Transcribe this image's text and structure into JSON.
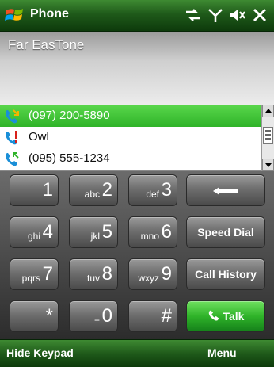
{
  "titlebar": {
    "title": "Phone",
    "start_icon": "windows-flag-icon",
    "status_icons": [
      "data-connection-icon",
      "signal-icon",
      "volume-icon",
      "close-icon"
    ]
  },
  "info": {
    "carrier": "Far EasTone"
  },
  "call_list": {
    "items": [
      {
        "label": "(097) 200-5890",
        "icon": "incoming-call-icon",
        "selected": true
      },
      {
        "label": "Owl",
        "icon": "missed-call-icon",
        "selected": false
      },
      {
        "label": "(095) 555-1234",
        "icon": "outgoing-call-icon",
        "selected": false
      }
    ]
  },
  "keypad": {
    "keys": [
      {
        "digit": "1",
        "letters": ""
      },
      {
        "digit": "2",
        "letters": "abc"
      },
      {
        "digit": "3",
        "letters": "def"
      },
      {
        "digit": "4",
        "letters": "ghi"
      },
      {
        "digit": "5",
        "letters": "jkl"
      },
      {
        "digit": "6",
        "letters": "mno"
      },
      {
        "digit": "7",
        "letters": "pqrs"
      },
      {
        "digit": "8",
        "letters": "tuv"
      },
      {
        "digit": "9",
        "letters": "wxyz"
      },
      {
        "digit": "*",
        "letters": ""
      },
      {
        "digit": "0",
        "letters": "+"
      },
      {
        "digit": "#",
        "letters": ""
      }
    ],
    "backspace_icon": "backspace-arrow-icon",
    "speed_dial": "Speed Dial",
    "call_history": "Call History",
    "talk": "Talk",
    "talk_icon": "phone-handset-icon"
  },
  "softkeys": {
    "left": "Hide Keypad",
    "right": "Menu"
  },
  "colors": {
    "bar_green": "#2a6e22",
    "selection_green": "#3fc436",
    "talk_green": "#2fb329"
  }
}
